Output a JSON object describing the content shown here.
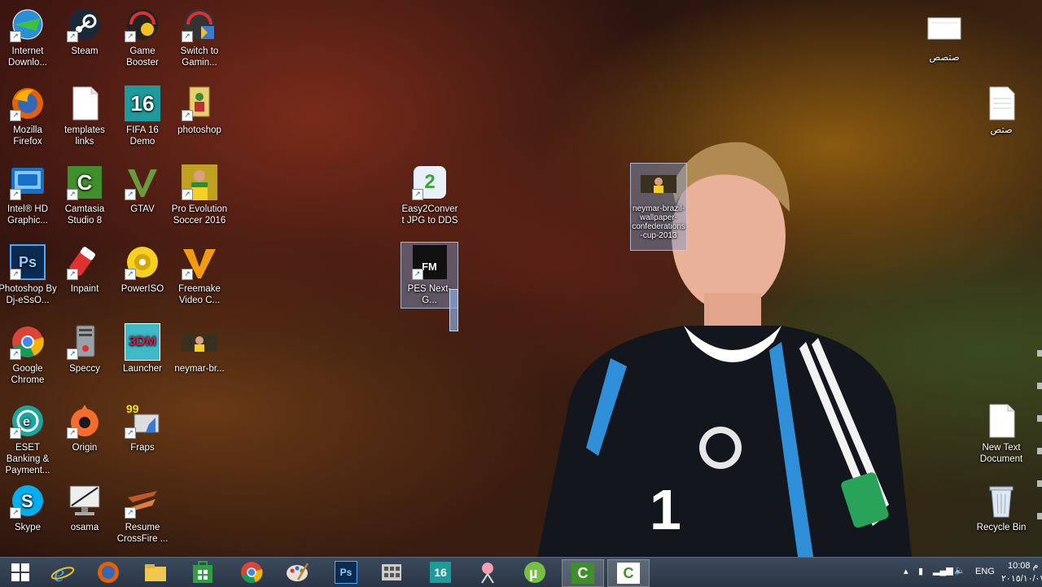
{
  "desktop_icons": [
    {
      "label": "Internet Downlo..."
    },
    {
      "label": "Steam"
    },
    {
      "label": "Game Booster"
    },
    {
      "label": "Switch to Gamin..."
    },
    {
      "label": "Mozilla Firefox"
    },
    {
      "label": "templates links"
    },
    {
      "label": "FIFA 16 Demo"
    },
    {
      "label": "photoshop"
    },
    {
      "label": "Intel® HD Graphic..."
    },
    {
      "label": "Camtasia Studio 8"
    },
    {
      "label": "GTAV"
    },
    {
      "label": "Pro Evolution Soccer 2016"
    },
    {
      "label": "Photoshop By Dj-eSsO..."
    },
    {
      "label": "Inpaint"
    },
    {
      "label": "PowerISO"
    },
    {
      "label": "Freemake Video C..."
    },
    {
      "label": "Google Chrome"
    },
    {
      "label": "Speccy"
    },
    {
      "label": "Launcher"
    },
    {
      "label": "neymar-br..."
    },
    {
      "label": "ESET Banking & Payment..."
    },
    {
      "label": "Origin"
    },
    {
      "label": "Fraps"
    },
    {
      "label": "Skype"
    },
    {
      "label": "osama"
    },
    {
      "label": "Resume CrossFire ..."
    },
    {
      "label": "Easy2Convert JPG to DDS"
    },
    {
      "label": "PES Next-G..."
    },
    {
      "label": "neymar-brazil-wallpaper-confederations-cup-2013"
    },
    {
      "label": "صتصص"
    },
    {
      "label": "صتص"
    },
    {
      "label": "New Text Document"
    },
    {
      "label": "Recycle Bin"
    }
  ],
  "icon_glyphs": {
    "fifa": "16",
    "launcher": "3DM",
    "fraps": "99",
    "camtasia": "C",
    "photoshop": "Ps",
    "easy2convert": "2",
    "pes": "FM"
  },
  "taskbar": {
    "pinned": [
      {
        "name": "start-button",
        "glyph": "⊞"
      },
      {
        "name": "internet-explorer",
        "glyph": "e"
      },
      {
        "name": "firefox",
        "glyph": "●"
      },
      {
        "name": "file-explorer",
        "glyph": "▬"
      },
      {
        "name": "store",
        "glyph": "▦"
      },
      {
        "name": "chrome",
        "glyph": "◉"
      },
      {
        "name": "paint",
        "glyph": "✎"
      },
      {
        "name": "photoshop",
        "glyph": "Ps"
      },
      {
        "name": "app-grid",
        "glyph": "▩"
      },
      {
        "name": "fifa",
        "glyph": "16"
      },
      {
        "name": "snipping",
        "glyph": "✂"
      },
      {
        "name": "utorrent",
        "glyph": "µ"
      },
      {
        "name": "camtasia-recorder",
        "glyph": "C"
      },
      {
        "name": "camtasia-studio",
        "glyph": "C"
      }
    ],
    "language": "ENG",
    "time": "10:08 م",
    "date": "٢٠١٥/١٠/٠٧"
  },
  "colors": {
    "taskbar": "#2a3646",
    "selection": "#7896c8",
    "jersey_blue": "#2f8fd8"
  }
}
